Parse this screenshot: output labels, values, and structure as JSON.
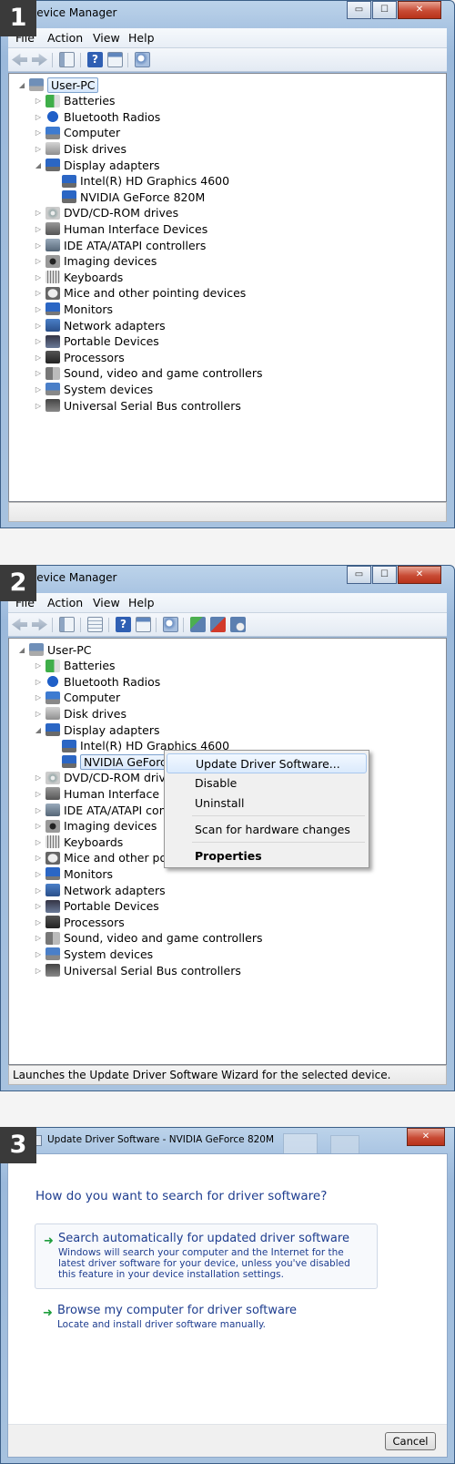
{
  "step_labels": [
    "1",
    "2",
    "3"
  ],
  "window": {
    "title": "Device Manager",
    "controls": {
      "minimize": "▭",
      "maximize": "☐",
      "close": "✕"
    }
  },
  "menu": {
    "file": "File",
    "action": "Action",
    "view": "View",
    "help": "Help"
  },
  "toolbar_icons": [
    "back-arrow-icon",
    "forward-arrow-icon",
    "console-tree-icon",
    "help-icon",
    "properties-icon",
    "scan-hardware-icon",
    "update-driver-icon",
    "uninstall-icon",
    "disable-icon"
  ],
  "tree": {
    "root": "User-PC",
    "categories": [
      {
        "label": "Batteries",
        "icon": "battery-icon"
      },
      {
        "label": "Bluetooth Radios",
        "icon": "bluetooth-icon"
      },
      {
        "label": "Computer",
        "icon": "computer-icon"
      },
      {
        "label": "Disk drives",
        "icon": "disk-drive-icon"
      },
      {
        "label": "Display adapters",
        "icon": "display-adapter-icon"
      },
      {
        "label": "Intel(R) HD Graphics 4600",
        "icon": "display-adapter-icon"
      },
      {
        "label": "NVIDIA GeForce 820M",
        "icon": "display-adapter-icon"
      },
      {
        "label": "DVD/CD-ROM drives",
        "icon": "dvd-drive-icon"
      },
      {
        "label": "Human Interface Devices",
        "icon": "hid-icon"
      },
      {
        "label": "IDE ATA/ATAPI controllers",
        "icon": "ide-controller-icon"
      },
      {
        "label": "Imaging devices",
        "icon": "camera-icon"
      },
      {
        "label": "Keyboards",
        "icon": "keyboard-icon"
      },
      {
        "label": "Mice and other pointing devices",
        "icon": "mouse-icon"
      },
      {
        "label": "Monitors",
        "icon": "monitor-icon"
      },
      {
        "label": "Network adapters",
        "icon": "network-adapter-icon"
      },
      {
        "label": "Portable Devices",
        "icon": "portable-device-icon"
      },
      {
        "label": "Processors",
        "icon": "processor-icon"
      },
      {
        "label": "Sound, video and game controllers",
        "icon": "speaker-icon"
      },
      {
        "label": "System devices",
        "icon": "system-device-icon"
      },
      {
        "label": "Universal Serial Bus controllers",
        "icon": "usb-icon"
      }
    ]
  },
  "context_menu": {
    "update_driver": "Update Driver Software...",
    "disable": "Disable",
    "uninstall": "Uninstall",
    "scan": "Scan for hardware changes",
    "properties": "Properties"
  },
  "status_step2": "Launches the Update Driver Software Wizard for the selected device.",
  "wizard": {
    "title": "Update Driver Software - NVIDIA GeForce 820M",
    "question": "How do you want to search for driver software?",
    "option_auto": {
      "title": "Search automatically for updated driver software",
      "desc": "Windows will search your computer and the Internet for the latest driver software for your device, unless you've disabled this feature in your device installation settings."
    },
    "option_browse": {
      "title": "Browse my computer for driver software",
      "desc": "Locate and install driver software manually."
    },
    "cancel": "Cancel",
    "arrow": "➜"
  },
  "colors": {
    "accent_blue": "#1e3d8f",
    "title_frame": "#a9c4e2",
    "close_red": "#c84b34"
  }
}
